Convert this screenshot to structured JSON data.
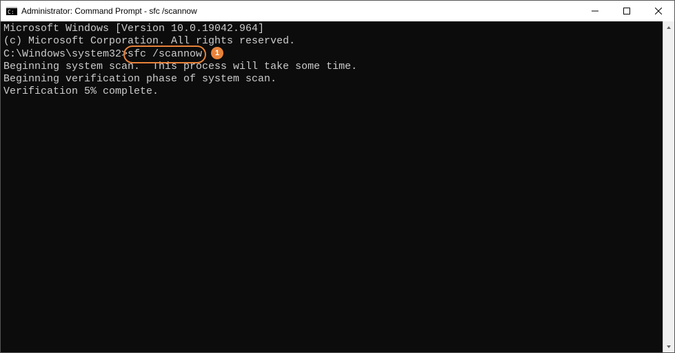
{
  "titlebar": {
    "title": "Administrator: Command Prompt - sfc  /scannow"
  },
  "terminal": {
    "line1": "Microsoft Windows [Version 10.0.19042.964]",
    "line2": "(c) Microsoft Corporation. All rights reserved.",
    "blank1": "",
    "prompt_prefix": "C:\\Windows\\system32>",
    "command": "sfc /scannow",
    "step_badge": "1",
    "blank2": "",
    "line_scan_start": "Beginning system scan.  This process will take some time.",
    "blank3": "",
    "line_verify": "Beginning verification phase of system scan.",
    "line_progress": "Verification 5% complete."
  }
}
